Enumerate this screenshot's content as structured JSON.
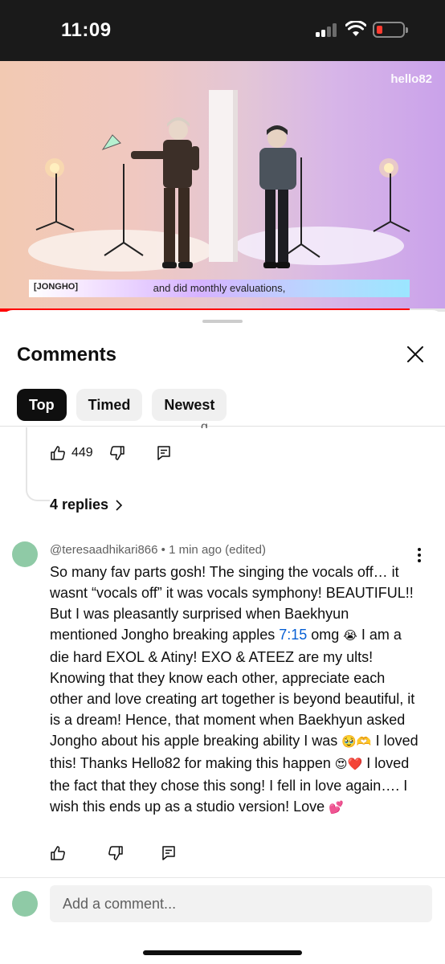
{
  "status_bar": {
    "time": "11:09",
    "battery_level": 0.15,
    "battery_color": "#ff3b30"
  },
  "video": {
    "watermark": "hello82",
    "caption_name": "[JONGHO]",
    "caption_text": "and did monthly evaluations,",
    "progress": 0.92,
    "progress_color": "#ff0000"
  },
  "comments_sheet": {
    "title": "Comments",
    "tabs": [
      {
        "label": "Top",
        "active": true
      },
      {
        "label": "Timed",
        "active": false
      },
      {
        "label": "Newest",
        "active": false
      }
    ],
    "previous_comment": {
      "cut_text": "g",
      "like_count": "449",
      "replies_label": "4 replies"
    },
    "comment": {
      "author": "@teresaadhikari866",
      "separator": "•",
      "time": "1 min ago (edited)",
      "text_1": "So many fav parts gosh! The singing the vocals off… it wasnt “vocals off” it was vocals symphony! BEAUTIFUL!! But I was pleasantly surprised when Baekhyun mentioned Jongho breaking apples ",
      "timestamp_link": "7:15",
      "text_2": " omg ",
      "emoji_1": "😭",
      "text_3": " I am a die hard EXOL & Atiny! EXO & ATEEZ are my ults! Knowing that they know each other, appreciate each other and love creating art together is beyond beautiful, it is a dream! Hence, that moment when Baekhyun asked Jongho about his apple breaking ability I was ",
      "emoji_2": "🥹🫶",
      "text_4": " I loved this! Thanks Hello82 for making this happen ",
      "emoji_3": "😍❤️",
      "text_5": " I loved the fact that they chose this song! I fell in love again…. I wish this ends up as a studio version! Love ",
      "emoji_4": "💕"
    },
    "add_comment_placeholder": "Add a comment...",
    "avatar_color": "#8fcaa6"
  }
}
